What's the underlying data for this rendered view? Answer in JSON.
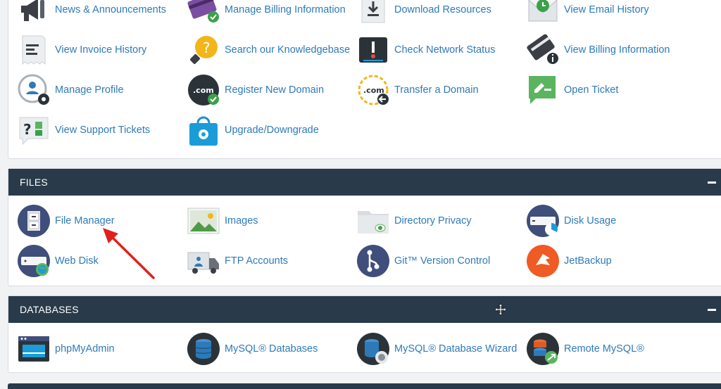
{
  "general": {
    "items": [
      {
        "label": "News & Announcements",
        "icon": "megaphone-icon"
      },
      {
        "label": "Manage Billing Information",
        "icon": "credit-card-check-icon"
      },
      {
        "label": "Download Resources",
        "icon": "download-icon"
      },
      {
        "label": "View Email History",
        "icon": "envelope-clock-icon"
      },
      {
        "label": "View Invoice History",
        "icon": "invoice-icon"
      },
      {
        "label": "Search our Knowledgebase",
        "icon": "lightbulb-question-icon"
      },
      {
        "label": "Check Network Status",
        "icon": "network-status-icon"
      },
      {
        "label": "View Billing Information",
        "icon": "card-info-icon"
      },
      {
        "label": "Manage Profile",
        "icon": "profile-gear-icon"
      },
      {
        "label": "Register New Domain",
        "icon": "domain-register-icon"
      },
      {
        "label": "Transfer a Domain",
        "icon": "domain-transfer-icon"
      },
      {
        "label": "Open Ticket",
        "icon": "ticket-edit-icon"
      },
      {
        "label": "View Support Tickets",
        "icon": "support-tickets-icon"
      },
      {
        "label": "Upgrade/Downgrade",
        "icon": "shopping-bag-gear-icon"
      }
    ]
  },
  "files": {
    "title": "FILES",
    "items": [
      {
        "label": "File Manager",
        "icon": "file-cabinet-icon"
      },
      {
        "label": "Images",
        "icon": "image-icon"
      },
      {
        "label": "Directory Privacy",
        "icon": "folder-eye-icon"
      },
      {
        "label": "Disk Usage",
        "icon": "disk-usage-icon"
      },
      {
        "label": "Web Disk",
        "icon": "web-disk-icon"
      },
      {
        "label": "FTP Accounts",
        "icon": "ftp-truck-icon"
      },
      {
        "label": "Git™ Version Control",
        "icon": "git-branch-icon"
      },
      {
        "label": "JetBackup",
        "icon": "jetbackup-icon"
      }
    ]
  },
  "databases": {
    "title": "DATABASES",
    "items": [
      {
        "label": "phpMyAdmin",
        "icon": "phpmyadmin-icon"
      },
      {
        "label": "MySQL® Databases",
        "icon": "database-icon"
      },
      {
        "label": "MySQL® Database Wizard",
        "icon": "database-wizard-icon"
      },
      {
        "label": "Remote MySQL®",
        "icon": "remote-database-icon"
      }
    ]
  },
  "colors": {
    "header": "#293a4a",
    "link": "#2e7ab8",
    "annotation_arrow": "#e0201d"
  }
}
